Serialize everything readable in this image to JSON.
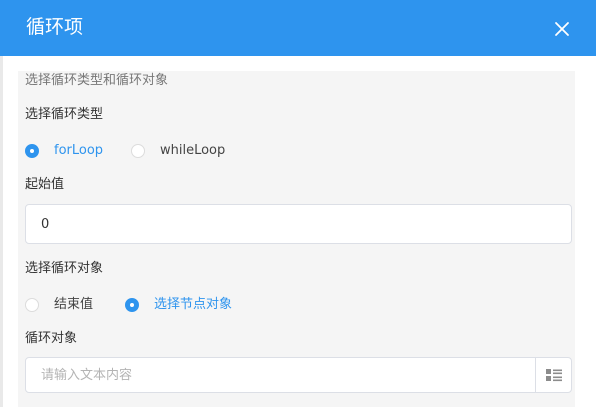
{
  "dialog": {
    "title": "循环项",
    "close_icon": "close-icon",
    "header_color": "#2e94ee"
  },
  "form": {
    "section_desc": "选择循环类型和循环对象",
    "loop_type": {
      "label": "选择循环类型",
      "options": [
        {
          "label": "forLoop",
          "checked": true
        },
        {
          "label": "whileLoop",
          "checked": false
        }
      ]
    },
    "start_value": {
      "label": "起始值",
      "value": "0"
    },
    "loop_object_type": {
      "label": "选择循环对象",
      "options": [
        {
          "label": "结束值",
          "checked": false
        },
        {
          "label": "选择节点对象",
          "checked": true
        }
      ]
    },
    "loop_object": {
      "label": "循环对象",
      "placeholder": "请输入文本内容",
      "value": "",
      "suffix_icon": "list-select-icon"
    }
  }
}
